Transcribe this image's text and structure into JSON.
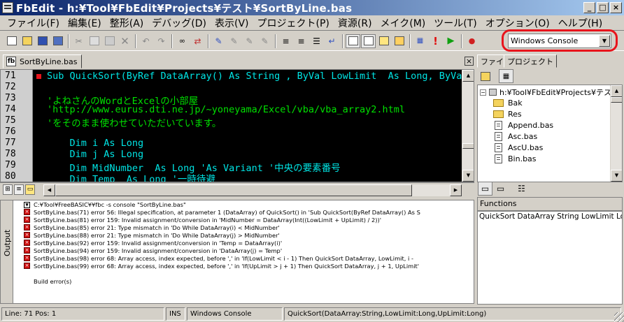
{
  "window": {
    "title": "FbEdit - h:¥Tool¥FbEdit¥Projects¥テスト¥SortByLine.bas"
  },
  "window_controls": {
    "minimize": "_",
    "maximize": "□",
    "close": "×"
  },
  "menu": [
    "ファイル(F)",
    "編集(E)",
    "整形(A)",
    "デバッグ(D)",
    "表示(V)",
    "プロジェクト(P)",
    "資源(R)",
    "メイク(M)",
    "ツール(T)",
    "オプション(O)",
    "ヘルプ(H)"
  ],
  "toolbar": {
    "build_mode": "Windows Console"
  },
  "document": {
    "tab_label": "SortByLine.bas",
    "tab_icon": "fb"
  },
  "editor": {
    "line_numbers": [
      "71",
      "72",
      "73",
      "74",
      "75",
      "76",
      "77",
      "78",
      "79",
      "80"
    ],
    "lines": [
      {
        "text": "Sub QuickSort(ByRef DataArray() As String , ByVal LowLimit  As Long, ByVa",
        "kind": "code"
      },
      {
        "text": "",
        "kind": "code"
      },
      {
        "text": "'よねさんのWordとExcelの小部屋",
        "kind": "comment"
      },
      {
        "text": "'http://www.eurus.dti.ne.jp/~yoneyama/Excel/vba/vba_array2.html",
        "kind": "comment"
      },
      {
        "text": "'をそのまま使わせていただいています。",
        "kind": "comment"
      },
      {
        "text": "",
        "kind": "code"
      },
      {
        "text": "    Dim i As Long",
        "kind": "code"
      },
      {
        "text": "    Dim j As Long",
        "kind": "code"
      },
      {
        "text": "    Dim MidNumber  As Long 'As Variant '中央の要素番号",
        "kind": "code"
      },
      {
        "text": "    Dim Temp  As Long '一時待避",
        "kind": "code"
      }
    ]
  },
  "output": {
    "label": "Output",
    "command": "C:¥Tool¥FreeBASIC¥¥fbc -s console \"SortByLine.bas\"",
    "errors": [
      "SortByLine.bas(71) error 56: Illegal specification, at parameter 1 (DataArray) of QuickSort() in 'Sub QuickSort(ByRef DataArray() As S",
      "SortByLine.bas(81) error 159: Invalid assignment/conversion in 'MidNumber = DataArray(Int((LowLimit + UpLimit) / 2))'",
      "SortByLine.bas(85) error 21: Type mismatch in 'Do While DataArray(i) < MidNumber'",
      "SortByLine.bas(88) error 21: Type mismatch in 'Do While DataArray(j) > MidNumber'",
      "SortByLine.bas(92) error 159: Invalid assignment/conversion in 'Temp = DataArray(i)'",
      "SortByLine.bas(94) error 159: Invalid assignment/conversion in 'DataArray(j) = Temp'",
      "SortByLine.bas(98) error 68: Array access, index expected, before ',' in 'If(LowLimit < i - 1) Then QuickSort DataArray, LowLimit, i -",
      "SortByLine.bas(99) error 68: Array access, index expected, before ',' in 'If(UpLimit > j + 1) Then QuickSort DataArray, j + 1, UpLimit'"
    ],
    "footer": "Build error(s)"
  },
  "right_panel": {
    "tabs": [
      "ファイル",
      "プロジェクト"
    ],
    "tree_root": "h:¥Tool¥FbEdit¥Projects¥テスト",
    "tree_items": [
      {
        "name": "Bak",
        "type": "folder"
      },
      {
        "name": "Res",
        "type": "folder"
      },
      {
        "name": "Append.bas",
        "type": "file"
      },
      {
        "name": "Asc.bas",
        "type": "file"
      },
      {
        "name": "AscU.bas",
        "type": "file"
      },
      {
        "name": "Bin.bas",
        "type": "file"
      }
    ],
    "functions_label": "Functions",
    "functions_list": "QuickSort DataArray String LowLimit Lon"
  },
  "statusbar": {
    "position": "Line: 71 Pos: 1",
    "mode": "INS",
    "build": "Windows Console",
    "signature": "QuickSort(DataArray:String,LowLimit:Long,UpLimit:Long)"
  }
}
